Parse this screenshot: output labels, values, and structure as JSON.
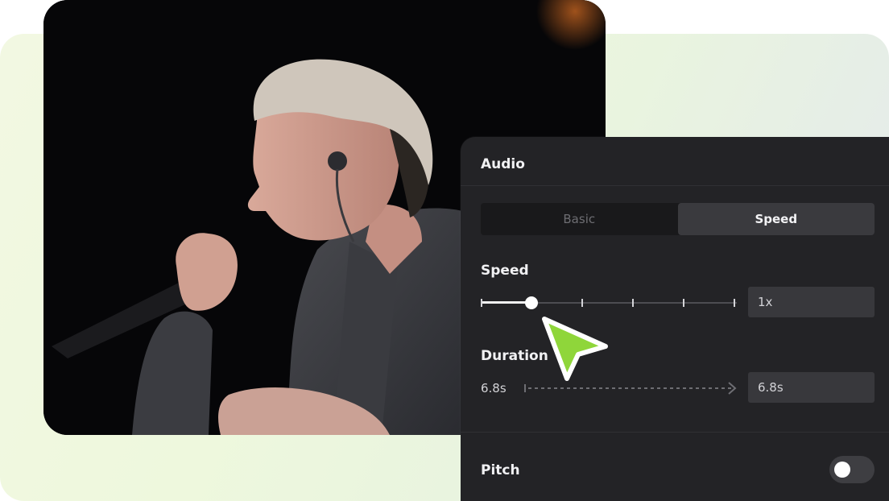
{
  "panel": {
    "title": "Audio",
    "tabs": [
      {
        "label": "Basic",
        "active": false
      },
      {
        "label": "Speed",
        "active": true
      }
    ],
    "speed": {
      "label": "Speed",
      "value": "1x",
      "slider_level": 0.2
    },
    "duration": {
      "label": "Duration",
      "from": "6.8s",
      "to": "6.8s"
    },
    "pitch": {
      "label": "Pitch",
      "enabled": false
    }
  },
  "colors": {
    "panel_bg": "#232326",
    "cursor_fill": "#8fd63a",
    "background_tint": "#eef8dd"
  }
}
